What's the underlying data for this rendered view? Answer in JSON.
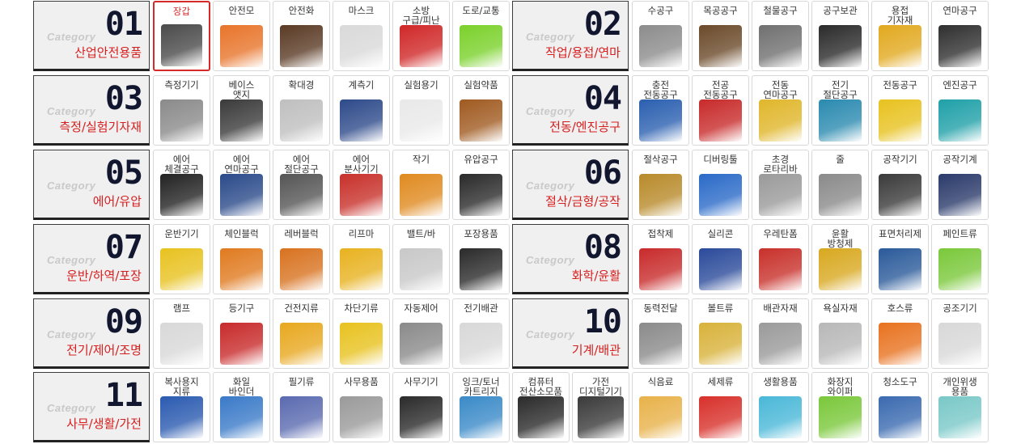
{
  "category_label": "Category",
  "rows": [
    {
      "categories": [
        {
          "number": "01",
          "title": "산업안전용품",
          "items": [
            {
              "name": "장갑",
              "icon": "glove-icon",
              "color": "#4a4a4a",
              "active": true
            },
            {
              "name": "안전모",
              "icon": "helmet-icon",
              "color": "#e8742a"
            },
            {
              "name": "안전화",
              "icon": "boot-icon",
              "color": "#5a3a24"
            },
            {
              "name": "마스크",
              "icon": "mask-icon",
              "color": "#d9d9d9"
            },
            {
              "name": "소방\n구급/피난",
              "icon": "extinguisher-icon",
              "color": "#d02727"
            },
            {
              "name": "도로/교통",
              "icon": "vest-icon",
              "color": "#7ad12a"
            }
          ]
        },
        {
          "number": "02",
          "title": "작업/용접/연마",
          "items": [
            {
              "name": "수공구",
              "icon": "wrench-icon",
              "color": "#8c8c8c"
            },
            {
              "name": "목공공구",
              "icon": "hammer-icon",
              "color": "#6b4a2a"
            },
            {
              "name": "철물공구",
              "icon": "chisel-icon",
              "color": "#707070"
            },
            {
              "name": "공구보관",
              "icon": "toolbag-icon",
              "color": "#2a2a2a"
            },
            {
              "name": "용접\n기자재",
              "icon": "welder-icon",
              "color": "#e2a91f"
            },
            {
              "name": "연마공구",
              "icon": "grinding-disc-icon",
              "color": "#2f2f2f"
            }
          ]
        }
      ]
    },
    {
      "categories": [
        {
          "number": "03",
          "title": "측정/실험기자재",
          "items": [
            {
              "name": "측정기기",
              "icon": "caliper-icon",
              "color": "#8a8a8a"
            },
            {
              "name": "베이스\n앳지",
              "icon": "magnetic-base-icon",
              "color": "#3a3a3a"
            },
            {
              "name": "확대경",
              "icon": "magnifier-icon",
              "color": "#bfbfbf"
            },
            {
              "name": "계측기",
              "icon": "clamp-meter-icon",
              "color": "#2d4a8a"
            },
            {
              "name": "실험용기",
              "icon": "mortar-icon",
              "color": "#e9e9e9"
            },
            {
              "name": "실험약품",
              "icon": "bottle-icon",
              "color": "#a05a20"
            }
          ]
        },
        {
          "number": "04",
          "title": "전동/엔진공구",
          "items": [
            {
              "name": "충전\n전동공구",
              "icon": "cordless-drill-icon",
              "color": "#2a5fb0"
            },
            {
              "name": "전공\n전동공구",
              "icon": "electric-drill-icon",
              "color": "#c82a2a"
            },
            {
              "name": "전동\n연마공구",
              "icon": "angle-grinder-icon",
              "color": "#e0b62a"
            },
            {
              "name": "전기\n절단공구",
              "icon": "circular-saw-icon",
              "color": "#2a8ab0"
            },
            {
              "name": "전동공구",
              "icon": "screwdriver-drill-icon",
              "color": "#e8c21f"
            },
            {
              "name": "엔진공구",
              "icon": "chainsaw-icon",
              "color": "#1fa0a8"
            }
          ]
        }
      ]
    },
    {
      "categories": [
        {
          "number": "05",
          "title": "에어/유압",
          "items": [
            {
              "name": "에어\n체결공구",
              "icon": "impact-wrench-icon",
              "color": "#222222"
            },
            {
              "name": "에어\n연마공구",
              "icon": "air-grinder-icon",
              "color": "#2a4a8a"
            },
            {
              "name": "에어\n절단공구",
              "icon": "air-cutter-icon",
              "color": "#555555"
            },
            {
              "name": "에어\n분사기기",
              "icon": "compressor-icon",
              "color": "#c8302a"
            },
            {
              "name": "작기",
              "icon": "jack-icon",
              "color": "#e08a1f"
            },
            {
              "name": "유압공구",
              "icon": "hydraulic-icon",
              "color": "#2a2a2a"
            }
          ]
        },
        {
          "number": "06",
          "title": "절삭/금형/공작",
          "items": [
            {
              "name": "절삭공구",
              "icon": "drill-bit-icon",
              "color": "#b88a2a"
            },
            {
              "name": "디버링툴",
              "icon": "deburring-icon",
              "color": "#2a6ac8"
            },
            {
              "name": "초경\n로타리바",
              "icon": "rotary-burr-icon",
              "color": "#9a9a9a"
            },
            {
              "name": "줄",
              "icon": "file-icon",
              "color": "#8a8a8a"
            },
            {
              "name": "공작기기",
              "icon": "chuck-icon",
              "color": "#3a3a3a"
            },
            {
              "name": "공작기계",
              "icon": "vise-icon",
              "color": "#2a3a6a"
            }
          ]
        }
      ]
    },
    {
      "categories": [
        {
          "number": "07",
          "title": "운반/하역/포장",
          "items": [
            {
              "name": "운반기기",
              "icon": "pallet-truck-icon",
              "color": "#e8c21f"
            },
            {
              "name": "체인블럭",
              "icon": "chain-hoist-icon",
              "color": "#e07a1f"
            },
            {
              "name": "레버블럭",
              "icon": "lever-hoist-icon",
              "color": "#d8721f"
            },
            {
              "name": "리프마",
              "icon": "lifting-magnet-icon",
              "color": "#e8b21f"
            },
            {
              "name": "밸트/바",
              "icon": "sling-belt-icon",
              "color": "#c8c8c8"
            },
            {
              "name": "포장용품",
              "icon": "tape-icon",
              "color": "#2a2a2a"
            }
          ]
        },
        {
          "number": "08",
          "title": "화학/윤활",
          "items": [
            {
              "name": "접착제",
              "icon": "adhesive-icon",
              "color": "#c82a2a"
            },
            {
              "name": "실리콘",
              "icon": "silicone-icon",
              "color": "#2a4a9a"
            },
            {
              "name": "우레탄폼",
              "icon": "urethane-foam-icon",
              "color": "#c8302a"
            },
            {
              "name": "윤활\n방청제",
              "icon": "lubricant-icon",
              "color": "#d8a81f"
            },
            {
              "name": "표면처리제",
              "icon": "spray-icon",
              "color": "#2a5a9a"
            },
            {
              "name": "페인트류",
              "icon": "paint-can-icon",
              "color": "#7ac83a"
            }
          ]
        }
      ]
    },
    {
      "categories": [
        {
          "number": "09",
          "title": "전기/제어/조명",
          "items": [
            {
              "name": "램프",
              "icon": "lamp-icon",
              "color": "#d8d8d8"
            },
            {
              "name": "등기구",
              "icon": "work-light-icon",
              "color": "#c82a2a"
            },
            {
              "name": "건전지류",
              "icon": "battery-icon",
              "color": "#e8a81f"
            },
            {
              "name": "차단기류",
              "icon": "breaker-icon",
              "color": "#e8c21f"
            },
            {
              "name": "자동제어",
              "icon": "inverter-icon",
              "color": "#8a8a8a"
            },
            {
              "name": "전기배관",
              "icon": "camera-icon",
              "color": "#d8d8d8"
            }
          ]
        },
        {
          "number": "10",
          "title": "기계/배관",
          "items": [
            {
              "name": "동력전달",
              "icon": "bearing-icon",
              "color": "#8a8a8a"
            },
            {
              "name": "볼트류",
              "icon": "bolt-icon",
              "color": "#d8b23a"
            },
            {
              "name": "배관자재",
              "icon": "pipe-icon",
              "color": "#9a9a9a"
            },
            {
              "name": "욕실자재",
              "icon": "shower-icon",
              "color": "#b8b8b8"
            },
            {
              "name": "호스류",
              "icon": "hose-icon",
              "color": "#e8721f"
            },
            {
              "name": "공조기기",
              "icon": "fan-icon",
              "color": "#d8d8d8"
            }
          ]
        }
      ]
    },
    {
      "categories": [
        {
          "number": "11",
          "title": "사무/생활/가전",
          "items": [
            {
              "name": "복사용지\n지류",
              "icon": "paper-icon",
              "color": "#2a5ab0"
            },
            {
              "name": "화일\n바인더",
              "icon": "binder-icon",
              "color": "#3a7ac8"
            },
            {
              "name": "필기류",
              "icon": "pen-icon",
              "color": "#5a6ab0"
            },
            {
              "name": "사무용품",
              "icon": "calculator-icon",
              "color": "#9a9a9a"
            },
            {
              "name": "사무기기",
              "icon": "printer-icon",
              "color": "#2a2a2a"
            },
            {
              "name": "잉크/토너\n카트리지",
              "icon": "ink-cartridge-icon",
              "color": "#3a8ac8"
            },
            {
              "name": "컴퓨터\n전산소모품",
              "icon": "laptop-icon",
              "color": "#2a2a2a",
              "wide": true
            },
            {
              "name": "가전\n디지털기기",
              "icon": "digital-camera-icon",
              "color": "#3a3a3a",
              "wide": true
            },
            {
              "name": "식음료",
              "icon": "coffee-icon",
              "color": "#e8b24a"
            },
            {
              "name": "세제류",
              "icon": "detergent-icon",
              "color": "#d8302a"
            },
            {
              "name": "생활용품",
              "icon": "umbrella-icon",
              "color": "#4ab8d8"
            },
            {
              "name": "화장지\n와이퍼",
              "icon": "tissue-icon",
              "color": "#7ac83a"
            },
            {
              "name": "청소도구",
              "icon": "trash-bin-icon",
              "color": "#3a6ab0"
            },
            {
              "name": "개인위생\n용품",
              "icon": "hygiene-icon",
              "color": "#7ac8c8"
            }
          ]
        }
      ]
    }
  ]
}
